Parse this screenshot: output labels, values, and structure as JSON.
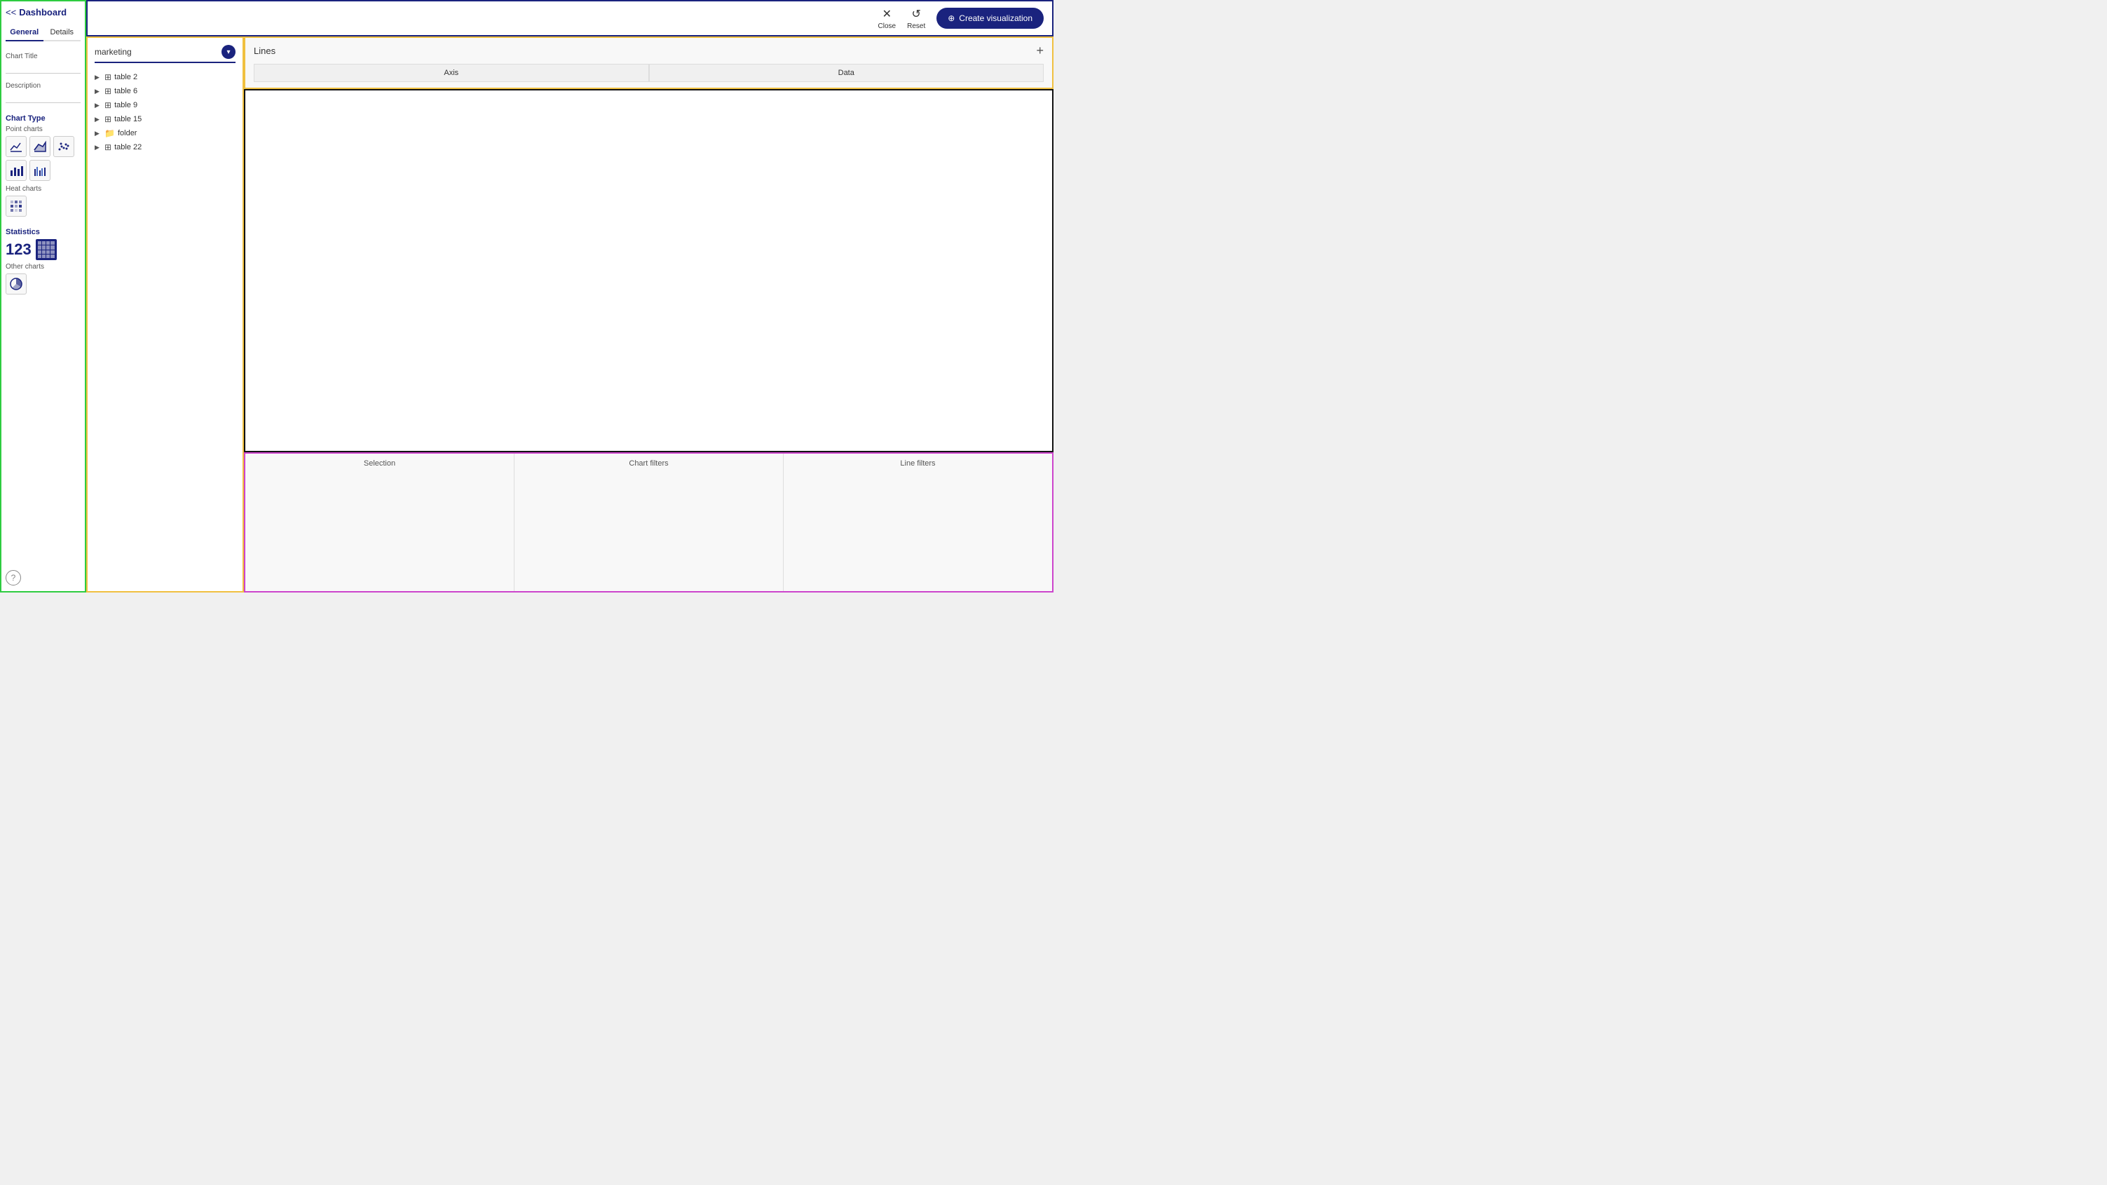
{
  "sidebar": {
    "title": "Dashboard",
    "back_label": "<<",
    "tabs": [
      {
        "label": "General",
        "active": true
      },
      {
        "label": "Details",
        "active": false
      }
    ],
    "chart_title_label": "Chart Title",
    "description_label": "Description",
    "chart_type_label": "Chart Type",
    "point_charts_label": "Point charts",
    "heat_charts_label": "Heat charts",
    "statistics_label": "Statistics",
    "other_charts_label": "Other charts",
    "stat_number": "123",
    "help_icon": "?"
  },
  "topbar": {
    "close_label": "Close",
    "reset_label": "Reset",
    "create_label": "Create visualization",
    "create_icon": "⊕"
  },
  "data_browser": {
    "search_value": "marketing",
    "items": [
      {
        "label": "table 2",
        "type": "table",
        "has_children": true
      },
      {
        "label": "table 6",
        "type": "table",
        "has_children": true
      },
      {
        "label": "table 9",
        "type": "table",
        "has_children": true
      },
      {
        "label": "table 15",
        "type": "table",
        "has_children": true
      },
      {
        "label": "folder",
        "type": "folder",
        "has_children": true
      },
      {
        "label": "table 22",
        "type": "table",
        "has_children": true
      }
    ]
  },
  "lines_panel": {
    "title": "Lines",
    "add_button": "+",
    "tabs": [
      {
        "label": "Axis"
      },
      {
        "label": "Data"
      }
    ]
  },
  "filters_panel": {
    "sections": [
      {
        "label": "Selection"
      },
      {
        "label": "Chart filters"
      },
      {
        "label": "Line filters"
      }
    ]
  }
}
